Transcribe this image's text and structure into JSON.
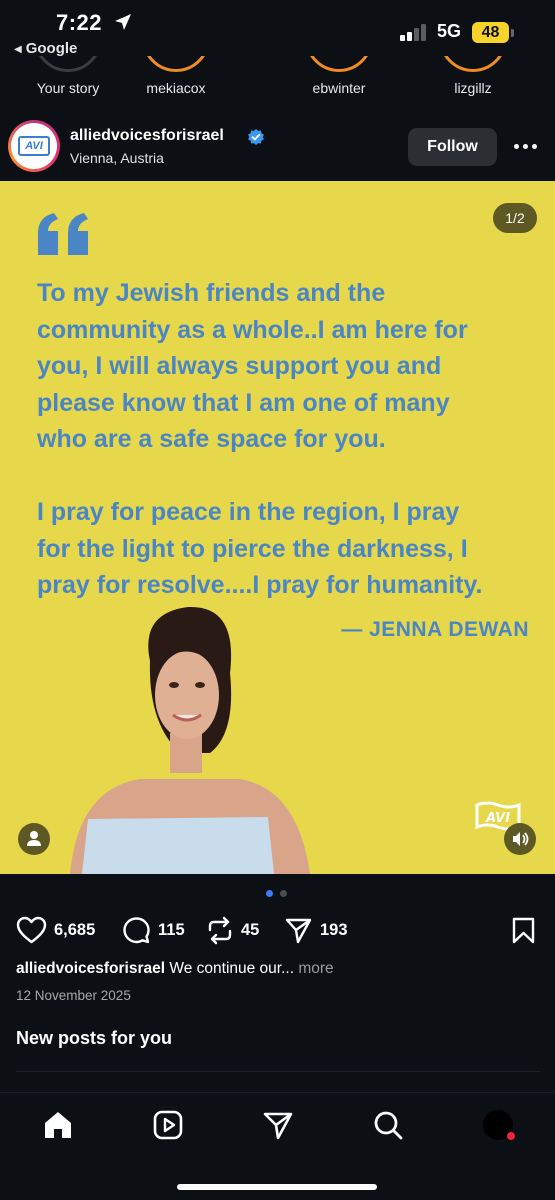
{
  "status_bar": {
    "time": "7:22",
    "back_app": "Google",
    "network": "5G",
    "battery": "48"
  },
  "stories": [
    {
      "label": "Your story"
    },
    {
      "label": "mekiacox"
    },
    {
      "label": "ebwinter"
    },
    {
      "label": "lizgillz"
    }
  ],
  "post": {
    "username": "alliedvoicesforisrael",
    "location": "Vienna, Austria",
    "follow_label": "Follow",
    "avatar_logo": "AVI",
    "image": {
      "counter": "1/2",
      "quote": "To my Jewish friends and the\ncommunity as a whole..I am here for\nyou, I will always support you and\nplease know that I am one of many\nwho are a safe space for you.\n\nI pray for peace in the region, I pray\nfor the light to pierce the darkness, I\npray for resolve....I pray for humanity.",
      "attribution": "— JENNA DEWAN",
      "watermark": "AVI",
      "carousel_index": 1,
      "carousel_total": 2
    },
    "likes": "6,685",
    "comments": "115",
    "reposts": "45",
    "shares": "193",
    "caption_user": "alliedvoicesforisrael",
    "caption_text": " We continue our... ",
    "caption_more": "more",
    "date": "12 November 2025"
  },
  "feed": {
    "new_posts_heading": "New posts for you"
  },
  "colors": {
    "background": "#0c0f14",
    "post_yellow": "#e6d84a",
    "quote_blue": "#4a86c5",
    "battery": "#f7d32b",
    "story_ring": "#f08a24",
    "carousel_active": "#3e7bf6"
  },
  "icons": [
    "location-arrow-icon",
    "verified-badge-icon",
    "more-options-icon",
    "quote-mark-icon",
    "user-tag-icon",
    "sound-icon",
    "heart-icon",
    "comment-icon",
    "repost-icon",
    "share-icon",
    "bookmark-icon",
    "home-icon",
    "reels-icon",
    "send-icon",
    "search-icon",
    "profile-avatar"
  ]
}
